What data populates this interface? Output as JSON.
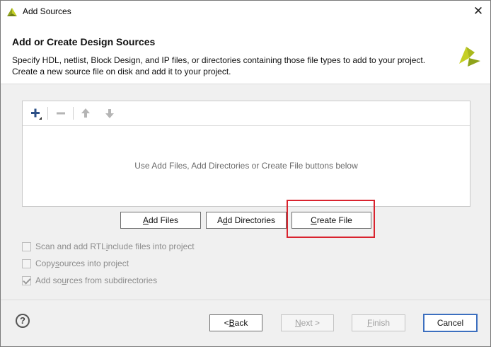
{
  "window": {
    "title": "Add Sources",
    "close_glyph": "✕"
  },
  "header": {
    "title": "Add or Create Design Sources",
    "line1": "Specify HDL, netlist, Block Design, and IP files, or directories containing those file types to add to your project.",
    "line2": "Create a new source file on disk and add it to your project."
  },
  "toolbar": {
    "icons": [
      "add-icon",
      "remove-icon",
      "move-up-icon",
      "move-down-icon"
    ]
  },
  "panel": {
    "empty_message": "Use Add Files, Add Directories or Create File buttons below"
  },
  "buttons": {
    "add_files": {
      "pre": "",
      "key": "A",
      "post": "dd Files"
    },
    "add_directories": {
      "pre": "A",
      "key": "d",
      "post": "d Directories"
    },
    "create_file": {
      "pre": "",
      "key": "C",
      "post": "reate File"
    }
  },
  "options": [
    {
      "pre": "Scan and add RTL ",
      "key": "i",
      "post": "nclude files into project",
      "checked": false
    },
    {
      "pre": "Copy ",
      "key": "s",
      "post": "ources into project",
      "checked": false
    },
    {
      "pre": "Add so",
      "key": "u",
      "post": "rces from subdirectories",
      "checked": true
    }
  ],
  "footer": {
    "help": "?",
    "back": {
      "pre": "< ",
      "key": "B",
      "post": "ack"
    },
    "next": {
      "pre": "",
      "key": "N",
      "post": "ext >"
    },
    "finish": {
      "pre": "",
      "key": "F",
      "post": "inish"
    },
    "cancel": "Cancel"
  },
  "colors": {
    "highlight": "#d9232e",
    "logo": "#b8c21a",
    "default_button_border": "#3c6fbf"
  }
}
